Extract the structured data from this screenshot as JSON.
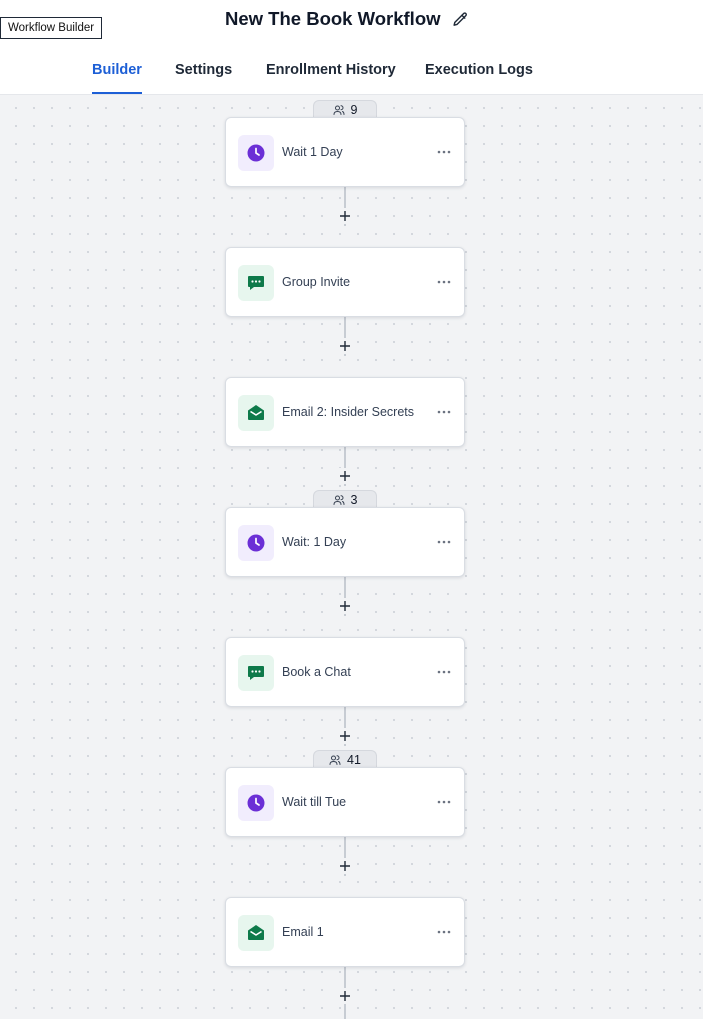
{
  "app_label": "Workflow Builder",
  "title": "New The Book Workflow",
  "tabs": [
    {
      "label": "Builder",
      "active": true
    },
    {
      "label": "Settings",
      "active": false
    },
    {
      "label": "Enrollment History",
      "active": false
    },
    {
      "label": "Execution Logs",
      "active": false
    }
  ],
  "badges": [
    "9",
    "3",
    "41"
  ],
  "steps": [
    {
      "label": "Wait 1 Day",
      "icon": "clock-icon"
    },
    {
      "label": "Group Invite",
      "icon": "chat-icon"
    },
    {
      "label": "Email 2: Insider Secrets",
      "icon": "email-icon"
    },
    {
      "label": "Wait: 1 Day",
      "icon": "clock-icon"
    },
    {
      "label": "Book a Chat",
      "icon": "chat-icon"
    },
    {
      "label": "Wait till Tue",
      "icon": "clock-icon"
    },
    {
      "label": "Email 1",
      "icon": "email-icon"
    }
  ],
  "colors": {
    "accent": "#1d5fd6",
    "wait_icon": "#6b2fd6",
    "message_icon": "#0e7a4a"
  }
}
